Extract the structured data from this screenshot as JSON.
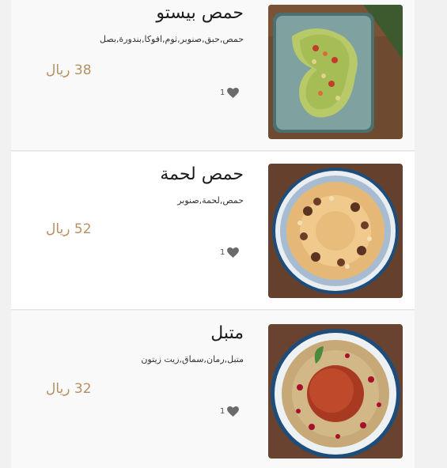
{
  "menu": {
    "items": [
      {
        "name": "حمص بيستو",
        "ingredients": "حمص,حبق,صنوبر,ثوم,افوكا,بندورة,بصل",
        "price": "38 ريال",
        "likes": "1",
        "image_icon": "hummus-pesto-photo"
      },
      {
        "name": "حمص لحمة",
        "ingredients": "حمص,لحمة,صنوبر",
        "price": "52 ريال",
        "likes": "1",
        "image_icon": "hummus-meat-photo"
      },
      {
        "name": "متبل",
        "ingredients": "متبل,رمان,سماق,زيت زيتون",
        "price": "32 ريال",
        "likes": "1",
        "image_icon": "mutabal-photo"
      }
    ]
  },
  "colors": {
    "price": "#b69062",
    "heart": "#6a6a6a",
    "card_bg": "#f9f9f9",
    "card_bg_alt": "#ffffff",
    "page_bg": "#f1f1f1"
  }
}
